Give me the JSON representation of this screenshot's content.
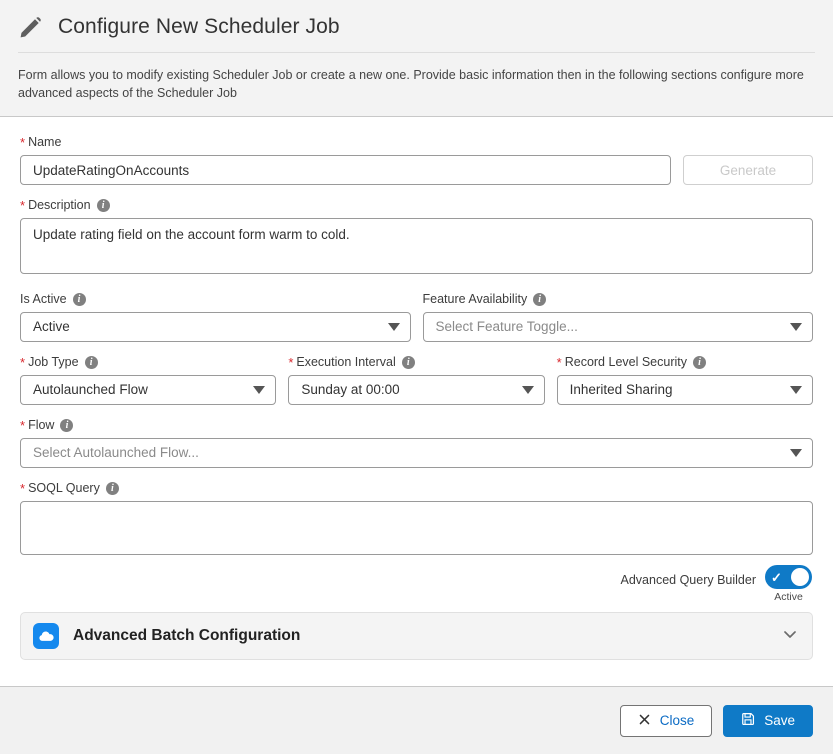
{
  "header": {
    "icon": "pencil-icon",
    "title": "Configure New Scheduler Job",
    "description": "Form allows you to modify existing Scheduler Job or create a new one. Provide basic information then in the following sections configure more advanced aspects of the Scheduler Job"
  },
  "form": {
    "name": {
      "label": "Name",
      "required": "*",
      "value": "UpdateRatingOnAccounts",
      "placeholder": ""
    },
    "generate_button": {
      "label": "Generate",
      "disabled": true
    },
    "description": {
      "label": "Description",
      "required": "*",
      "info": "info-icon",
      "value": "Update rating field on the account form warm to cold.",
      "placeholder": ""
    },
    "is_active": {
      "label": "Is Active",
      "info": "info-icon",
      "value": "Active"
    },
    "feature_availability": {
      "label": "Feature Availability",
      "info": "info-icon",
      "value": "",
      "placeholder": "Select Feature Toggle..."
    },
    "job_type": {
      "label": "Job Type",
      "required": "*",
      "info": "info-icon",
      "value": "Autolaunched Flow"
    },
    "execution_interval": {
      "label": "Execution Interval",
      "required": "*",
      "info": "info-icon",
      "value": "Sunday at 00:00"
    },
    "record_level_security": {
      "label": "Record Level Security",
      "required": "*",
      "info": "info-icon",
      "value": "Inherited Sharing"
    },
    "flow": {
      "label": "Flow",
      "required": "*",
      "info": "info-icon",
      "value": "",
      "placeholder": "Select Autolaunched Flow..."
    },
    "soql_query": {
      "label": "SOQL Query",
      "required": "*",
      "info": "info-icon",
      "value": "",
      "placeholder": ""
    },
    "advanced_query_builder": {
      "label": "Advanced Query Builder",
      "state_label": "Active",
      "checked": true
    }
  },
  "accordion": {
    "icon": "cloud-icon",
    "title": "Advanced Batch Configuration",
    "chevron": "chevron-down-icon",
    "expanded": false
  },
  "footer": {
    "close": {
      "label": "Close",
      "icon": "close-x-icon"
    },
    "save": {
      "label": "Save",
      "icon": "save-disk-icon"
    }
  },
  "colors": {
    "accent": "#0f7ac7",
    "icon_blue": "#1589ee",
    "required_red": "#d8282e",
    "header_bg": "#f3f3f3",
    "footer_bg": "#f1f1f1"
  }
}
